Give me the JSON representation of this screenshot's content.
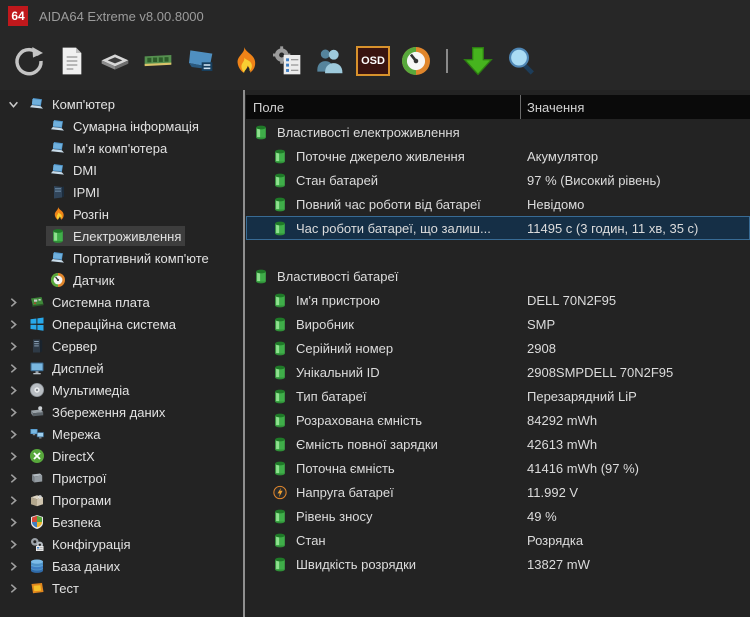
{
  "window": {
    "title": "AIDA64 Extreme v8.00.8000",
    "logo_text": "64"
  },
  "toolbar": {
    "items": [
      {
        "id": "refresh",
        "icon": "refresh-icon"
      },
      {
        "id": "report",
        "icon": "report-icon"
      },
      {
        "id": "cpu",
        "icon": "cpu-icon"
      },
      {
        "id": "memory",
        "icon": "memory-icon"
      },
      {
        "id": "video",
        "icon": "video-icon"
      },
      {
        "id": "burn",
        "icon": "flame-icon"
      },
      {
        "id": "preferences",
        "icon": "preferences-icon"
      },
      {
        "id": "users",
        "icon": "users-icon"
      },
      {
        "id": "osd",
        "icon": "osd-icon",
        "label": "OSD"
      },
      {
        "id": "gauge",
        "icon": "gauge-icon"
      },
      {
        "id": "separator"
      },
      {
        "id": "update",
        "icon": "update-icon"
      },
      {
        "id": "search",
        "icon": "search-icon"
      }
    ]
  },
  "sidebar": {
    "items": [
      {
        "id": "computer",
        "label": "Комп'ютер",
        "icon": "laptop",
        "level": 0,
        "expanded": true
      },
      {
        "id": "summary",
        "label": "Сумарна інформація",
        "icon": "laptop",
        "level": 1
      },
      {
        "id": "computer-name",
        "label": "Ім'я комп'ютера",
        "icon": "laptop",
        "level": 1
      },
      {
        "id": "dmi",
        "label": "DMI",
        "icon": "laptop",
        "level": 1
      },
      {
        "id": "ipmi",
        "label": "IPMI",
        "icon": "serverbox",
        "level": 1
      },
      {
        "id": "overclock",
        "label": "Розгін",
        "icon": "flame",
        "level": 1
      },
      {
        "id": "power",
        "label": "Електроживлення",
        "icon": "battery",
        "level": 1,
        "selected": true
      },
      {
        "id": "portable",
        "label": "Портативний комп'юте",
        "icon": "laptop",
        "level": 1
      },
      {
        "id": "sensor",
        "label": "Датчик",
        "icon": "gauge",
        "level": 1
      },
      {
        "id": "motherboard",
        "label": "Системна плата",
        "icon": "motherboard",
        "level": 0
      },
      {
        "id": "os",
        "label": "Операційна система",
        "icon": "windows",
        "level": 0
      },
      {
        "id": "server",
        "label": "Сервер",
        "icon": "server",
        "level": 0
      },
      {
        "id": "display",
        "label": "Дисплей",
        "icon": "display",
        "level": 0
      },
      {
        "id": "multimedia",
        "label": "Мультимедіа",
        "icon": "multimedia",
        "level": 0
      },
      {
        "id": "storage",
        "label": "Збереження даних",
        "icon": "storage",
        "level": 0
      },
      {
        "id": "network",
        "label": "Мережа",
        "icon": "network",
        "level": 0
      },
      {
        "id": "directx",
        "label": "DirectX",
        "icon": "directx",
        "level": 0
      },
      {
        "id": "devices",
        "label": "Пристрої",
        "icon": "devices",
        "level": 0
      },
      {
        "id": "programs",
        "label": "Програми",
        "icon": "programs",
        "level": 0
      },
      {
        "id": "security",
        "label": "Безпека",
        "icon": "security",
        "level": 0
      },
      {
        "id": "config",
        "label": "Конфігурація",
        "icon": "config",
        "level": 0
      },
      {
        "id": "database",
        "label": "База даних",
        "icon": "database",
        "level": 0
      },
      {
        "id": "test",
        "label": "Тест",
        "icon": "test",
        "level": 0
      }
    ]
  },
  "main": {
    "columns": [
      "Поле",
      "Значення"
    ],
    "rows": [
      {
        "type": "section",
        "icon": "battery",
        "field": "Властивості електроживлення",
        "value": ""
      },
      {
        "type": "item",
        "icon": "battery",
        "field": "Поточне джерело живлення",
        "value": "Акумулятор"
      },
      {
        "type": "item",
        "icon": "battery",
        "field": "Стан батарей",
        "value": "97 % (Високий рівень)"
      },
      {
        "type": "item",
        "icon": "battery",
        "field": "Повний час роботи від батареї",
        "value": "Невідомо"
      },
      {
        "type": "item",
        "icon": "battery",
        "field": "Час роботи батареї, що залиш...",
        "value": "11495 с (3 годин, 11 хв, 35 с)",
        "selected": true
      },
      {
        "type": "spacer"
      },
      {
        "type": "section",
        "icon": "battery",
        "field": "Властивості батареї",
        "value": ""
      },
      {
        "type": "item",
        "icon": "battery",
        "field": "Ім'я пристрою",
        "value": "DELL 70N2F95"
      },
      {
        "type": "item",
        "icon": "battery",
        "field": "Виробник",
        "value": "SMP"
      },
      {
        "type": "item",
        "icon": "battery",
        "field": "Серійний номер",
        "value": "2908"
      },
      {
        "type": "item",
        "icon": "battery",
        "field": "Унікальний ID",
        "value": "2908SMPDELL 70N2F95"
      },
      {
        "type": "item",
        "icon": "battery",
        "field": "Тип батареї",
        "value": "Перезарядний LiP"
      },
      {
        "type": "item",
        "icon": "battery",
        "field": "Розрахована ємність",
        "value": "84292 mWh"
      },
      {
        "type": "item",
        "icon": "battery",
        "field": "Ємність повної зарядки",
        "value": "42613 mWh"
      },
      {
        "type": "item",
        "icon": "battery",
        "field": "Поточна ємність",
        "value": "41416 mWh  (97 %)"
      },
      {
        "type": "item",
        "icon": "voltage",
        "field": "Напруга батареї",
        "value": "11.992 V"
      },
      {
        "type": "item",
        "icon": "battery",
        "field": "Рівень зносу",
        "value": "49 %"
      },
      {
        "type": "item",
        "icon": "battery",
        "field": "Стан",
        "value": "Розрядка"
      },
      {
        "type": "item",
        "icon": "battery",
        "field": "Швидкість розрядки",
        "value": "13827 mW"
      }
    ]
  },
  "colors": {
    "brand_red": "#c0181c",
    "battery_green": "#3fae49",
    "accent_orange": "#e0862c",
    "selection_bg": "#152f46",
    "selection_border": "#386b94",
    "sidebar_selected_bg": "#3d3d3d"
  }
}
